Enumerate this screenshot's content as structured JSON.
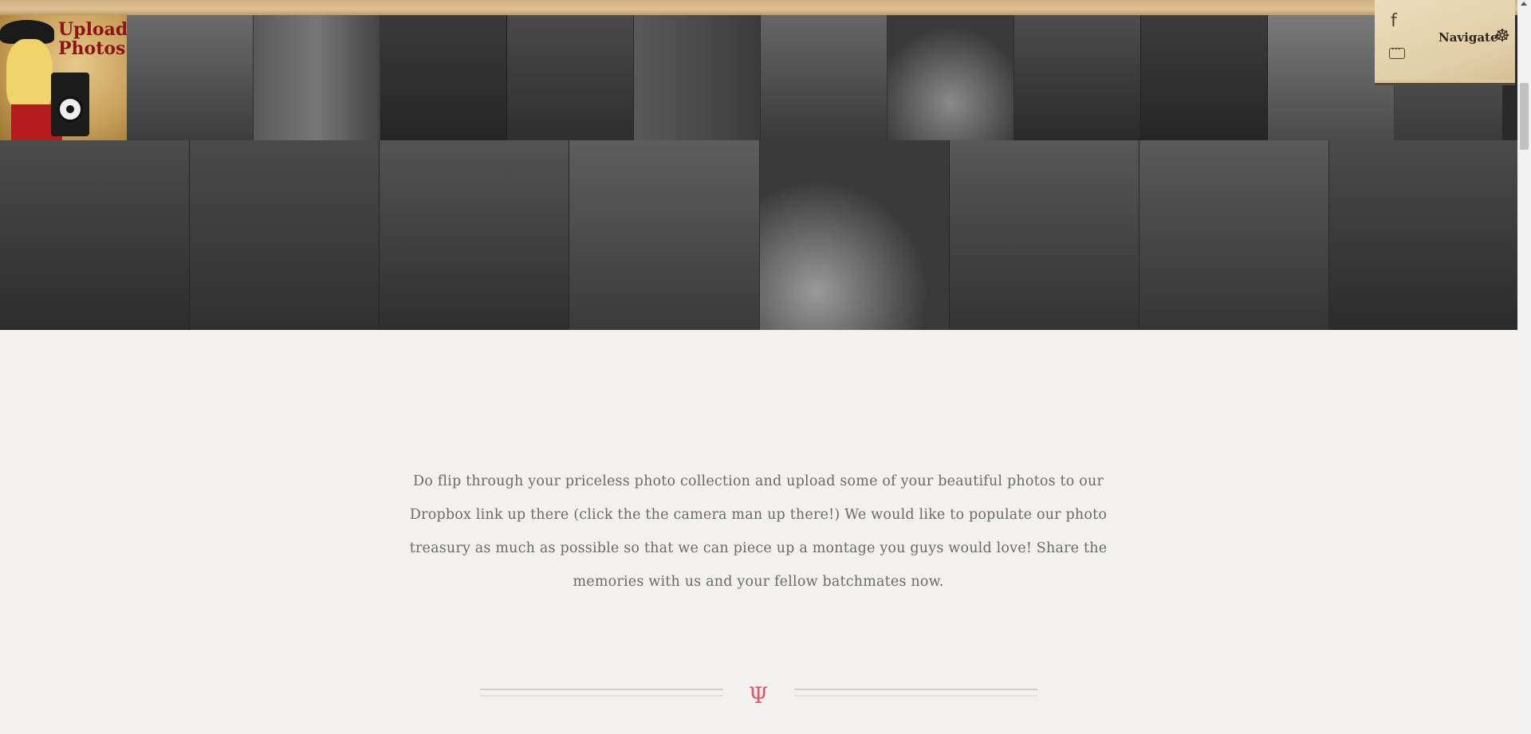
{
  "upload_tile": {
    "label": "Upload Photos!"
  },
  "nav_widget": {
    "label": "Navigate",
    "facebook_glyph": "f",
    "wheel_glyph": "☸",
    "icons": [
      "facebook-icon",
      "chat-icon",
      "ships-wheel-icon"
    ]
  },
  "gallery": {
    "row1": [
      "photo-1",
      "photo-2",
      "photo-3",
      "photo-4",
      "photo-5",
      "photo-6",
      "photo-7",
      "photo-8",
      "photo-9",
      "photo-10",
      "photo-11",
      "photo-12"
    ],
    "row2": [
      "photo-13",
      "photo-14",
      "photo-15",
      "photo-16",
      "photo-17",
      "photo-18",
      "photo-19",
      "photo-20"
    ]
  },
  "main": {
    "paragraph": "Do flip through your priceless photo collection and upload some of your beautiful photos to our Dropbox link up there (click the the camera man up there!) We would like to populate our photo treasury as much as possible so that we can piece up a montage you guys would love! Share the memories with us and your fellow batchmates now."
  },
  "divider": {
    "glyph": "Ψ"
  },
  "colors": {
    "accent": "#e0586a",
    "body_text": "#6a6a6a",
    "background": "#f2f1ef",
    "poster_red": "#8c1418"
  }
}
